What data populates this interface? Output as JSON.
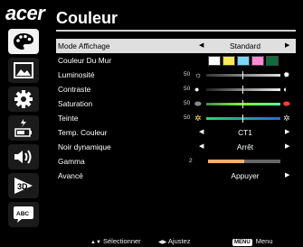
{
  "brand": {
    "logo_text": "acer"
  },
  "header": {
    "title": "Couleur"
  },
  "sidebar": {
    "items": [
      {
        "icon": "palette-icon",
        "active": true
      },
      {
        "icon": "picture-icon",
        "active": false
      },
      {
        "icon": "gear-icon",
        "active": false
      },
      {
        "icon": "power-management-icon",
        "active": false
      },
      {
        "icon": "speaker-icon",
        "active": false
      },
      {
        "icon": "3d-icon",
        "active": false,
        "text": "3D"
      },
      {
        "icon": "abc-language-icon",
        "active": false,
        "text": "ABC"
      }
    ]
  },
  "menu": {
    "mode_affichage": {
      "label": "Mode Affichage",
      "value": "Standard"
    },
    "couleur_du_mur": {
      "label": "Couleur Du Mur",
      "swatches": [
        "#ffffff",
        "#ffe65a",
        "#7fd4ff",
        "#ff8ad8",
        "#0e6b3a"
      ]
    },
    "luminosite": {
      "label": "Luminosité",
      "value": "50",
      "level": 0.5
    },
    "contraste": {
      "label": "Contraste",
      "value": "50",
      "level": 0.5
    },
    "saturation": {
      "label": "Saturation",
      "value": "50",
      "level": 0.5
    },
    "teinte": {
      "label": "Teinte",
      "value": "50",
      "level": 0.5
    },
    "temp_couleur": {
      "label": "Temp. Couleur",
      "value": "CT1"
    },
    "noir_dynamique": {
      "label": "Noir dynamique",
      "value": "Arrêt"
    },
    "gamma": {
      "label": "Gamma",
      "value": "2",
      "level": 0.5
    },
    "avance": {
      "label": "Avancé",
      "value": "Appuyer"
    }
  },
  "footer": {
    "select": {
      "glyph": "▲▼",
      "label": "Sélectionner"
    },
    "adjust": {
      "glyph": "◀▶",
      "label": "Ajustez"
    },
    "menu": {
      "badge": "MENU",
      "label": "Menu"
    }
  },
  "colors": {
    "selected_row": "#dfdfdf",
    "gamma_fill": "#f0b070",
    "saturation_left": "#7fff3a",
    "teinte_left": "#2ad66a"
  }
}
